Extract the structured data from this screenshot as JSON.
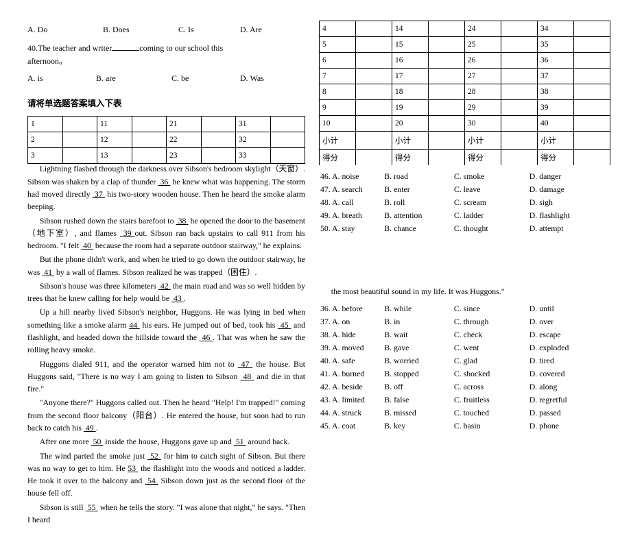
{
  "left": {
    "q39_choices": [
      "A. Do",
      "B. Does",
      "C. Is",
      "D. Are"
    ],
    "q40_text_a": "40.The teacher and writer",
    "q40_text_b": "coming to our school this",
    "q40_text_c": "afternoon。",
    "q40_choices": [
      "A. is",
      "B. are",
      "C. be",
      "D. Was"
    ],
    "instruction": "请将单选题答案填入下表",
    "ans_rows": [
      [
        "1",
        "",
        "11",
        "",
        "21",
        "",
        "31",
        ""
      ],
      [
        "2",
        "",
        "12",
        "",
        "22",
        "",
        "32",
        ""
      ],
      [
        "3",
        "",
        "13",
        "",
        "23",
        "",
        "33",
        ""
      ]
    ],
    "passage": {
      "p1a": "Lightning flashed through the darkness over Sibson's bedroom skylight（天窗）. Sibson was shaken by a clap of thunder ",
      "p1b": "36",
      "p1c": " he knew what was happening. The storm had moved directly ",
      "p1d": "37",
      "p1e": " his two-story wooden house. Then he heard the smoke alarm beeping.",
      "p2a": "Sibson rushed down the stairs barefoot to ",
      "p2b": "38",
      "p2c": " he opened the door to the basement（地下室）, and flames ",
      "p2d": "39 ",
      "p2e": "out. Sibson ran back upstairs to call 911 from his bedroom. \"I felt ",
      "p2f": "40",
      "p2g": " because the room had a separate outdoor stairway,\" he explains.",
      "p3a": "But the phone didn't work, and when he tried to go down the outdoor stairway, he was ",
      "p3b": "41",
      "p3c": " by a wall of flames. Sibson realized he was trapped（困住）.",
      "p4a": "Sibson's house was three kilometers ",
      "p4b": "42",
      "p4c": " the main road and was so well hidden by trees that he knew calling for help would be ",
      "p4d": "43",
      "p4e": ".",
      "p5a": "Up a hill nearby lived Sibson's neighbor, Huggons. He was lying in bed when something like a smoke alarm ",
      "p5b": "44",
      "p5c": " his ears. He jumped out of bed, took his ",
      "p5d": "45",
      "p5e": " and flashlight, and headed down the hillside toward the ",
      "p5f": "46",
      "p5g": ". That was when he saw the rolling heavy smoke.",
      "p6a": "Huggons dialed 911, and the operator warned him not to ",
      "p6b": "47",
      "p6c": " the house. But Huggons said, \"There is no way I am going to listen to Sibson ",
      "p6d": "48",
      "p6e": " and die in that fire.\"",
      "p7a": "\"Anyone there?\" Huggons called out. Then he heard \"Help! I'm trapped!\" coming from the second floor balcony（阳台）. He entered the house, but soon had to run back to catch his ",
      "p7b": "49",
      "p7c": ".",
      "p8a": "After one more ",
      "p8b": "50",
      "p8c": " inside the house, Huggons gave up and ",
      "p8d": "51",
      "p8e": " around back.",
      "p9a": "The wind parted the smoke just ",
      "p9b": "52",
      "p9c": " for him to catch sight of Sibson. But there was no way to get to him. He ",
      "p9d": "53",
      "p9e": " the flashlight into the woods and noticed a ladder. He took it over to the balcony and ",
      "p9f": "54",
      "p9g": " Sibson down just as the second floor of the house fell off.",
      "p10a": "Sibson is still ",
      "p10b": "55",
      "p10c": " when he tells the story. \"I was alone that night,\" he says. \"Then I heard"
    }
  },
  "right": {
    "ans_rows": [
      [
        "4",
        "",
        "14",
        "",
        "24",
        "",
        "34",
        ""
      ],
      [
        "5",
        "",
        "15",
        "",
        "25",
        "",
        "35",
        ""
      ],
      [
        "6",
        "",
        "16",
        "",
        "26",
        "",
        "36",
        ""
      ],
      [
        "7",
        "",
        "17",
        "",
        "27",
        "",
        "37",
        ""
      ],
      [
        "8",
        "",
        "18",
        "",
        "28",
        "",
        "38",
        ""
      ],
      [
        "9",
        "",
        "19",
        "",
        "29",
        "",
        "39",
        ""
      ],
      [
        "10",
        "",
        "20",
        "",
        "30",
        "",
        "40",
        ""
      ]
    ],
    "subtotal": [
      "小计",
      "",
      "小计",
      "",
      "小计",
      "",
      "小计",
      ""
    ],
    "score": [
      "得分",
      "",
      "得分",
      "",
      "得分",
      "",
      "得分",
      ""
    ],
    "opts46_50": [
      [
        "46. A. noise",
        "B. road",
        "C. smoke",
        "D. danger"
      ],
      [
        "47. A. search",
        "B. enter",
        "C. leave",
        "D. damage"
      ],
      [
        "48. A. call",
        "B. roll",
        "C. scream",
        "D. sigh"
      ],
      [
        "49. A. breath",
        "B. attention",
        "C. ladder",
        "D. flashlight"
      ],
      [
        "50. A. stay",
        "B. chance",
        "C. thought",
        "D. attempt"
      ]
    ],
    "footer": "the most beautiful sound in my life. It was Huggons.\"",
    "opts36_45": [
      [
        "36. A. before",
        "B. while",
        "C. since",
        "D. until"
      ],
      [
        "37. A. on",
        "B. in",
        "C. through",
        "D. over"
      ],
      [
        "38. A. hide",
        "B. wait",
        "C. check",
        "D. escape"
      ],
      [
        "39. A. moved",
        "B. gave",
        "C. went",
        "D. exploded"
      ],
      [
        "40. A. safe",
        "B. worried",
        "C. glad",
        "D. tired"
      ],
      [
        "41. A. burned",
        "B. stopped",
        "C. shocked",
        "D. covered"
      ],
      [
        "42. A. beside",
        "B. off",
        "C. across",
        "D. along"
      ],
      [
        "43. A. limited",
        "B. false",
        "C. fruitless",
        "D. regretful"
      ],
      [
        "44. A. struck",
        "B. missed",
        "C. touched",
        "D. passed"
      ],
      [
        "45. A. coat",
        "B. key",
        "C. basin",
        "D. phone"
      ]
    ]
  }
}
